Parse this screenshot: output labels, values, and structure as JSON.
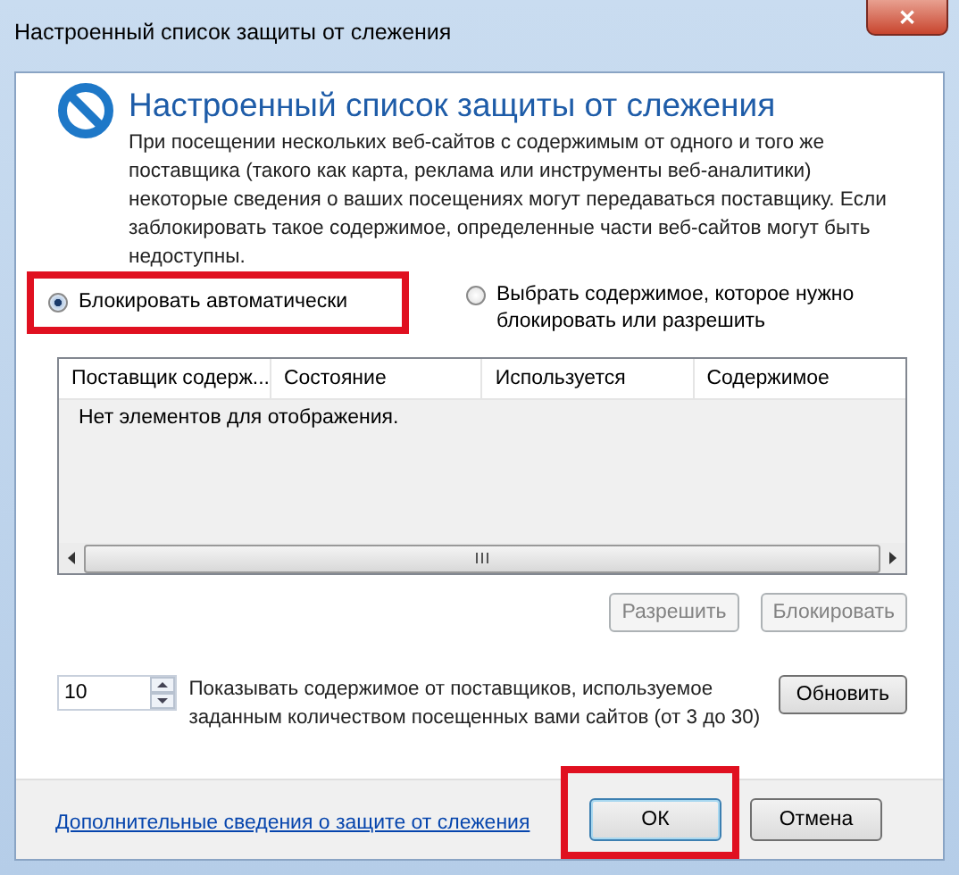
{
  "window": {
    "title": "Настроенный список защиты от слежения",
    "close": "✕"
  },
  "heading": "Настроенный список защиты от слежения",
  "description": "При посещении нескольких веб-сайтов с содержимым от одного и того же поставщика (такого как карта, реклама или инструменты веб-аналитики) некоторые сведения о ваших посещениях могут передаваться поставщику. Если заблокировать такое содержимое, определенные части веб-сайтов могут быть недоступны.",
  "modes": [
    {
      "label": "Блокировать автоматически",
      "selected": true,
      "highlighted": true
    },
    {
      "label": "Выбрать содержимое, которое нужно блокировать или разрешить",
      "selected": false,
      "highlighted": false
    }
  ],
  "table": {
    "columns": [
      "Поставщик содерж...",
      "Состояние",
      "Используется",
      "Содержимое"
    ],
    "empty_text": "Нет элементов для отображения."
  },
  "list_buttons": [
    {
      "label": "Разрешить",
      "disabled": true
    },
    {
      "label": "Блокировать",
      "disabled": true
    }
  ],
  "threshold": {
    "value": "10",
    "label": "Показывать содержимое от поставщиков, используемое заданным количеством посещенных вами сайтов (от 3 до 30)",
    "button": "Обновить"
  },
  "footer": {
    "link": "Дополнительные сведения о защите от слежения",
    "buttons": [
      {
        "label": "ОК",
        "highlighted": true
      },
      {
        "label": "Отмена",
        "highlighted": false
      }
    ]
  }
}
